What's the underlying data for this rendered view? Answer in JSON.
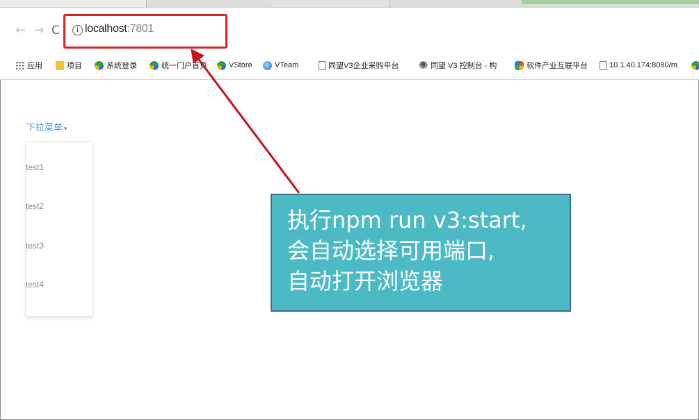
{
  "toolbar": {
    "back_icon": "←",
    "forward_icon": "→",
    "reload_icon": "C",
    "info_icon": "i",
    "url_host": "localhost",
    "url_port": ":7801"
  },
  "bookmarks": [
    {
      "label": "应用",
      "icon": "apps-icon"
    },
    {
      "label": "项目",
      "icon": "folder-icon"
    },
    {
      "label": "系统登录",
      "icon": "leaf-icon"
    },
    {
      "label": "统一门户首页",
      "icon": "leaf-icon"
    },
    {
      "label": "VStore",
      "icon": "leaf-icon"
    },
    {
      "label": "VTeam",
      "icon": "vteam-icon"
    },
    {
      "label": "同望V3企业采购平台",
      "icon": "page-icon"
    },
    {
      "label": "同望 V3 控制台 - 构",
      "icon": "person-icon"
    },
    {
      "label": "软件产业互联平台",
      "icon": "star-icon"
    },
    {
      "label": "10.1.40.174:8080/m",
      "icon": "page-icon"
    }
  ],
  "page": {
    "dropdown_label": "下拉菜单",
    "dropdown_caret": "▾",
    "menu_items": [
      "test1",
      "test2",
      "test3",
      "test4"
    ]
  },
  "annotation": {
    "lines": [
      "执行npm run v3:start,",
      "会自动选择可用端口,",
      "自动打开浏览器"
    ],
    "highlight_color": "#e0201f",
    "callout_color": "#4bbac4",
    "arrow_color": "#c0141a"
  }
}
